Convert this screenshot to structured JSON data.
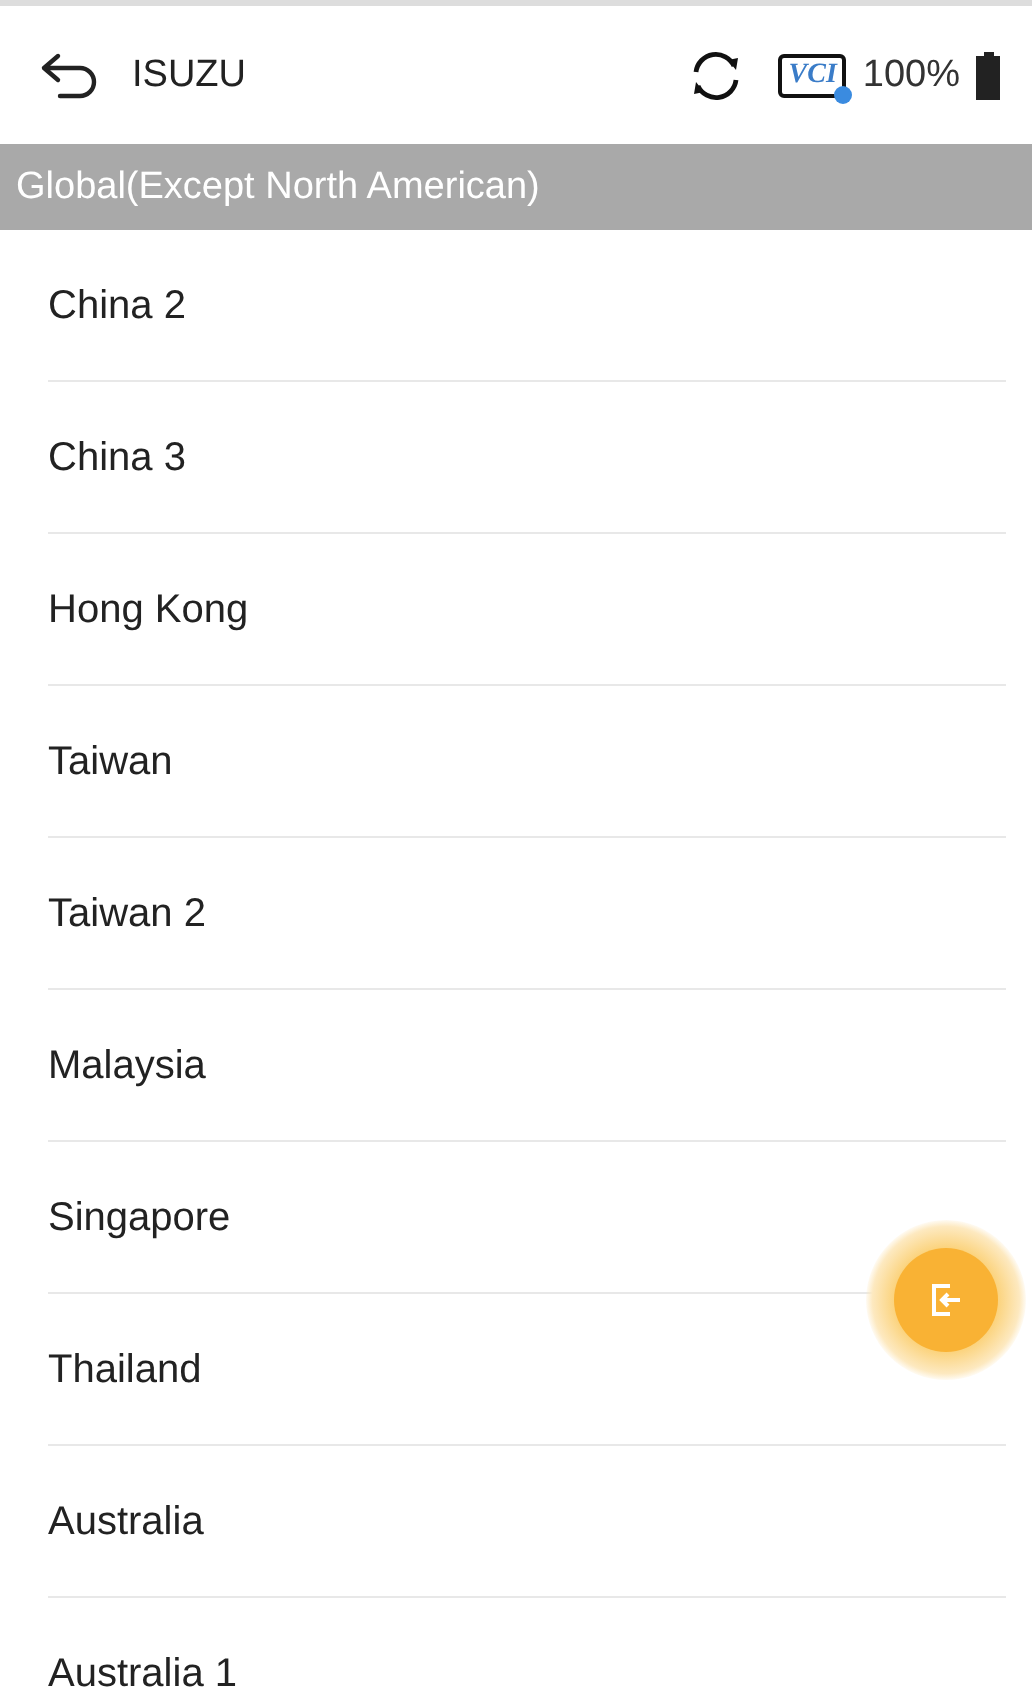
{
  "header": {
    "title": "ISUZU",
    "vci_label": "VCI",
    "vci_connected": true,
    "battery_text": "100%"
  },
  "section": {
    "title": "Global(Except North American)"
  },
  "items": [
    {
      "label": "China 2"
    },
    {
      "label": "China 3"
    },
    {
      "label": "Hong Kong"
    },
    {
      "label": "Taiwan"
    },
    {
      "label": "Taiwan 2"
    },
    {
      "label": "Malaysia"
    },
    {
      "label": "Singapore"
    },
    {
      "label": "Thailand"
    },
    {
      "label": "Australia"
    },
    {
      "label": "Australia 1"
    }
  ]
}
